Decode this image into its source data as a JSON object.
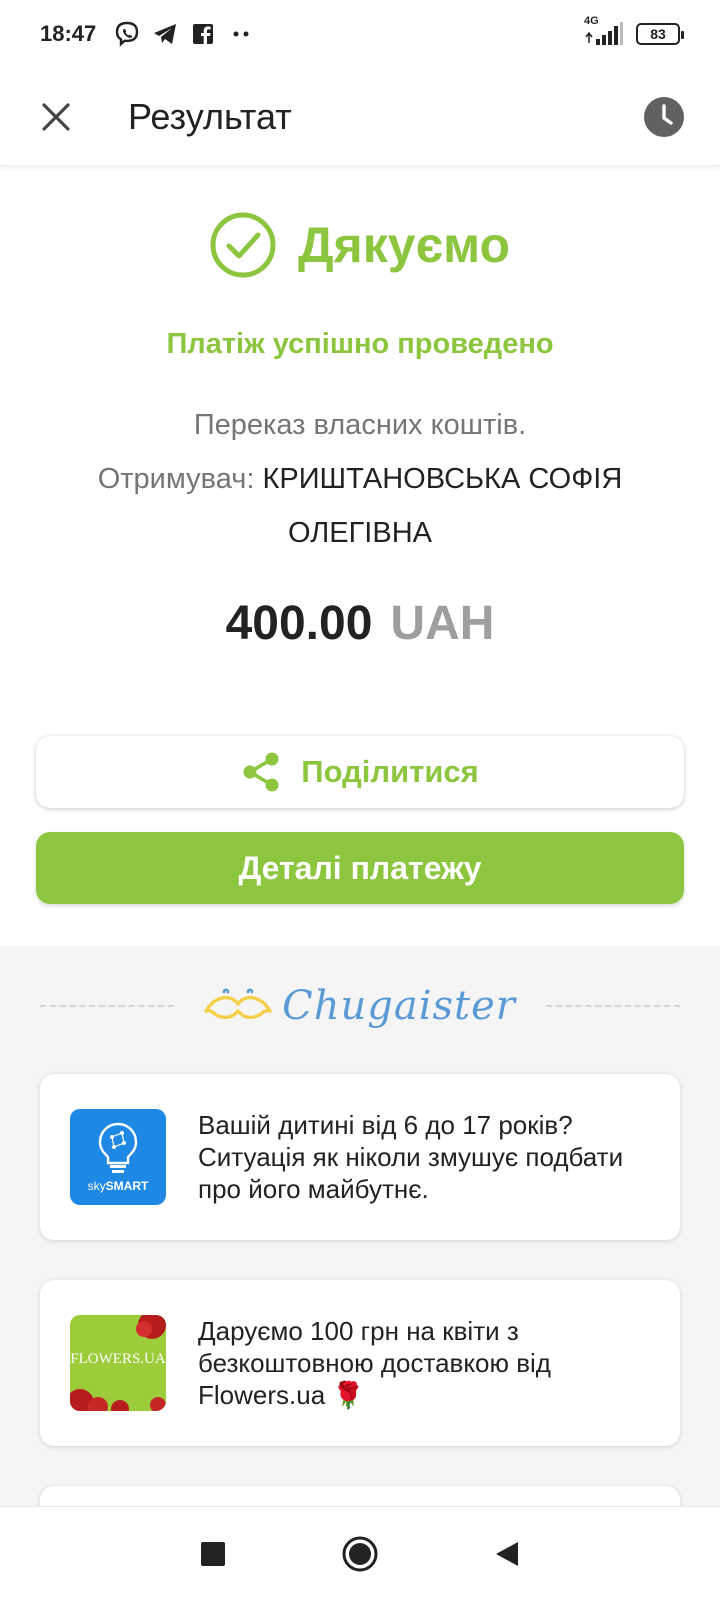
{
  "status_bar": {
    "time": "18:47",
    "network": "4G",
    "battery": "83",
    "icons": [
      "viber-icon",
      "telegram-icon",
      "facebook-icon",
      "more-notifications-icon",
      "signal-icon",
      "battery-icon"
    ]
  },
  "app_bar": {
    "title": "Результат",
    "close_icon": "close-icon",
    "history_icon": "clock-icon"
  },
  "result": {
    "heading": "Дякуємо",
    "status": "Платіж успішно проведено",
    "description": "Переказ власних коштів.",
    "recipient_label": "Отримувач:",
    "recipient_name": "КРИШТАНОВСЬКА СОФІЯ ОЛЕГІВНА",
    "amount": "400.00",
    "currency": "UAH"
  },
  "actions": {
    "share_label": "Поділитися",
    "details_label": "Деталі платежу"
  },
  "promo": {
    "brand": "Chugaister",
    "offers": [
      {
        "logo": "skysmart-logo",
        "logo_text": "sky",
        "logo_text_bold": "SMART",
        "text": "Вашій дитині від 6 до 17 років? Ситуація як ніколи змушує подбати про його майбутнє."
      },
      {
        "logo": "flowers-ua-logo",
        "logo_text": "FLOWERS.UA",
        "text": "Даруємо 100 грн на квіти з безкоштовною доставкою від Flowers.ua 🌹"
      }
    ]
  },
  "nav": {
    "items": [
      "recents-button",
      "home-button",
      "back-button"
    ]
  },
  "colors": {
    "accent": "#8cc63f",
    "muted_text": "#757575",
    "currency": "#9e9e9e",
    "brand_blue": "#5b9bd5",
    "brand_yellow": "#f5cf4a"
  }
}
